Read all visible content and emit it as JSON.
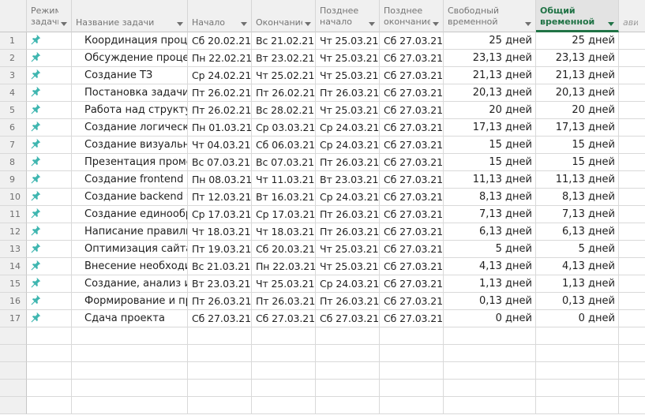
{
  "headers": {
    "mode": "Режим\nзадачи",
    "name": "Название задачи",
    "start": "Начало",
    "finish": "Окончание",
    "late_start": "Позднее\nначало",
    "late_finish": "Позднее\nокончание",
    "free_slack": "Свободный\nвременной",
    "total_slack": "Общий\nвременной",
    "extra": "авит"
  },
  "mode_icon": "pin-icon",
  "colors": {
    "pin": "#3fb6b0",
    "active_header": "#217346"
  },
  "rows": [
    {
      "num": "1",
      "name": "Координация процессов",
      "start": "Сб 20.02.21",
      "finish": "Вс 21.02.21",
      "late_start": "Чт 25.03.21",
      "late_finish": "Сб 27.03.21",
      "free": "25 дней",
      "total": "25 дней"
    },
    {
      "num": "2",
      "name": "Обсуждение процессов",
      "start": "Пн 22.02.21",
      "finish": "Вт 23.02.21",
      "late_start": "Чт 25.03.21",
      "late_finish": "Сб 27.03.21",
      "free": "23,13 дней",
      "total": "23,13 дней"
    },
    {
      "num": "3",
      "name": "Создание ТЗ",
      "start": "Ср 24.02.21",
      "finish": "Чт 25.02.21",
      "late_start": "Чт 25.03.21",
      "late_finish": "Сб 27.03.21",
      "free": "21,13 дней",
      "total": "21,13 дней"
    },
    {
      "num": "4",
      "name": "Постановка задачи с",
      "start": "Пт 26.02.21",
      "finish": "Пт 26.02.21",
      "late_start": "Пт 26.03.21",
      "late_finish": "Сб 27.03.21",
      "free": "20,13 дней",
      "total": "20,13 дней"
    },
    {
      "num": "5",
      "name": "Работа над структур",
      "start": "Пт 26.02.21",
      "finish": "Вс 28.02.21",
      "late_start": "Чт 25.03.21",
      "late_finish": "Сб 27.03.21",
      "free": "20 дней",
      "total": "20 дней"
    },
    {
      "num": "6",
      "name": "Создание логическо",
      "start": "Пн 01.03.21",
      "finish": "Ср 03.03.21",
      "late_start": "Ср 24.03.21",
      "late_finish": "Сб 27.03.21",
      "free": "17,13 дней",
      "total": "17,13 дней"
    },
    {
      "num": "7",
      "name": "Создание визуально",
      "start": "Чт 04.03.21",
      "finish": "Сб 06.03.21",
      "late_start": "Ср 24.03.21",
      "late_finish": "Сб 27.03.21",
      "free": "15 дней",
      "total": "15 дней"
    },
    {
      "num": "8",
      "name": "Презентация промеж",
      "start": "Вс 07.03.21",
      "finish": "Вс 07.03.21",
      "late_start": "Пт 26.03.21",
      "late_finish": "Сб 27.03.21",
      "free": "15 дней",
      "total": "15 дней"
    },
    {
      "num": "9",
      "name": "Создание frontend ч",
      "start": "Пн 08.03.21",
      "finish": "Чт 11.03.21",
      "late_start": "Вт 23.03.21",
      "late_finish": "Сб 27.03.21",
      "free": "11,13 дней",
      "total": "11,13 дней"
    },
    {
      "num": "10",
      "name": "Создание backend ча",
      "start": "Пт 12.03.21",
      "finish": "Вт 16.03.21",
      "late_start": "Ср 24.03.21",
      "late_finish": "Сб 27.03.21",
      "free": "8,13 дней",
      "total": "8,13 дней"
    },
    {
      "num": "11",
      "name": "Создание единообр",
      "start": "Ср 17.03.21",
      "finish": "Ср 17.03.21",
      "late_start": "Пт 26.03.21",
      "late_finish": "Сб 27.03.21",
      "free": "7,13 дней",
      "total": "7,13 дней"
    },
    {
      "num": "12",
      "name": "Написание правилы",
      "start": "Чт 18.03.21",
      "finish": "Чт 18.03.21",
      "late_start": "Пт 26.03.21",
      "late_finish": "Сб 27.03.21",
      "free": "6,13 дней",
      "total": "6,13 дней"
    },
    {
      "num": "13",
      "name": "Оптимизация сайта п",
      "start": "Пт 19.03.21",
      "finish": "Сб 20.03.21",
      "late_start": "Чт 25.03.21",
      "late_finish": "Сб 27.03.21",
      "free": "5 дней",
      "total": "5 дней"
    },
    {
      "num": "14",
      "name": "Внесение необходи",
      "start": "Вс 21.03.21",
      "finish": "Пн 22.03.21",
      "late_start": "Чт 25.03.21",
      "late_finish": "Сб 27.03.21",
      "free": "4,13 дней",
      "total": "4,13 дней"
    },
    {
      "num": "15",
      "name": "Создание, анализ и п",
      "start": "Вт 23.03.21",
      "finish": "Чт 25.03.21",
      "late_start": "Ср 24.03.21",
      "late_finish": "Сб 27.03.21",
      "free": "1,13 дней",
      "total": "1,13 дней"
    },
    {
      "num": "16",
      "name": "Формирование и пр",
      "start": "Пт 26.03.21",
      "finish": "Пт 26.03.21",
      "late_start": "Пт 26.03.21",
      "late_finish": "Сб 27.03.21",
      "free": "0,13 дней",
      "total": "0,13 дней"
    },
    {
      "num": "17",
      "name": "Сдача проекта",
      "start": "Сб 27.03.21",
      "finish": "Сб 27.03.21",
      "late_start": "Сб 27.03.21",
      "late_finish": "Сб 27.03.21",
      "free": "0 дней",
      "total": "0 дней"
    }
  ]
}
